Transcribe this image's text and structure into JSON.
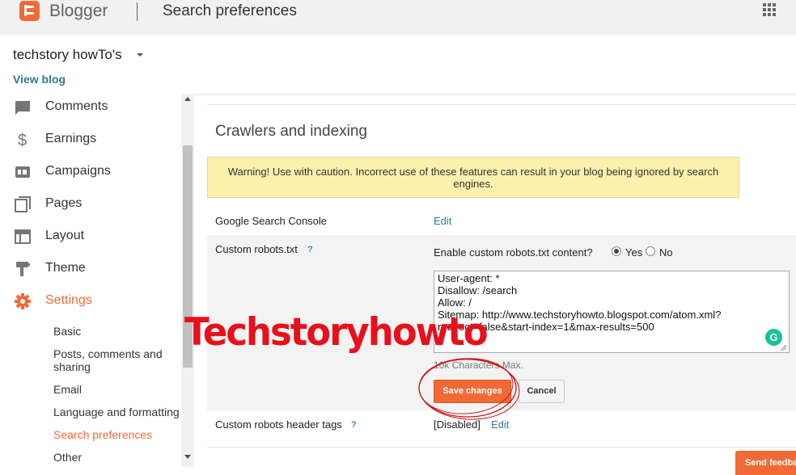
{
  "app": {
    "name": "Blogger",
    "page_title": "Search preferences"
  },
  "blog": {
    "name": "techstory howTo's",
    "view_blog": "View blog"
  },
  "sidebar": {
    "items": [
      {
        "label": "Comments",
        "icon": "comment-icon"
      },
      {
        "label": "Earnings",
        "icon": "dollar-icon"
      },
      {
        "label": "Campaigns",
        "icon": "ad-icon"
      },
      {
        "label": "Pages",
        "icon": "pages-icon"
      },
      {
        "label": "Layout",
        "icon": "layout-icon"
      },
      {
        "label": "Theme",
        "icon": "paint-roller-icon"
      },
      {
        "label": "Settings",
        "icon": "gear-icon",
        "active": true
      }
    ],
    "settings_subitems": [
      {
        "label": "Basic"
      },
      {
        "label": "Posts, comments and sharing"
      },
      {
        "label": "Email"
      },
      {
        "label": "Language and formatting"
      },
      {
        "label": "Search preferences",
        "active": true
      },
      {
        "label": "Other"
      }
    ]
  },
  "main": {
    "section_title": "Crawlers and indexing",
    "warning": "Warning! Use with caution. Incorrect use of these features can result in your blog being ignored by search engines.",
    "google_search_console": {
      "label": "Google Search Console",
      "action": "Edit"
    },
    "custom_robots": {
      "label": "Custom robots.txt",
      "help": "?",
      "enable_question": "Enable custom robots.txt content?",
      "yes_label": "Yes",
      "no_label": "No",
      "selected": "Yes",
      "content": "User-agent: *\nDisallow: /search\nAllow: /\nSitemap: http://www.techstoryhowto.blogspot.com/atom.xml?redirect=false&start-index=1&max-results=500",
      "char_limit": "10k Characters Max.",
      "save_label": "Save changes",
      "cancel_label": "Cancel"
    },
    "custom_header_tags": {
      "label": "Custom robots header tags",
      "help": "?",
      "status": "[Disabled]",
      "action": "Edit"
    }
  },
  "feedback_label": "Send feedback",
  "watermark": "Techstoryhowto",
  "colors": {
    "accent": "#f06a35",
    "link": "#2f7a8c",
    "warning_bg": "#fcf0ad",
    "watermark": "#e8101a"
  }
}
